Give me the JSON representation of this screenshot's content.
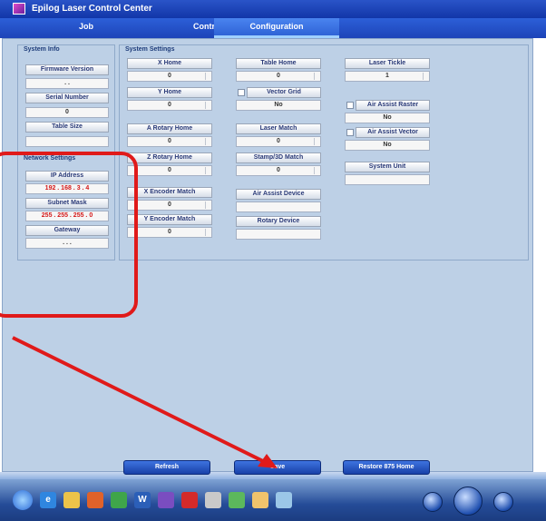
{
  "window": {
    "title": "Epilog Laser Control Center"
  },
  "tabs": [
    {
      "label": "Job"
    },
    {
      "label": "Control"
    },
    {
      "label": "Configuration"
    }
  ],
  "system_info": {
    "label": "System Info",
    "firmware_version": {
      "label": "Firmware Version",
      "value": ". ."
    },
    "serial_number": {
      "label": "Serial Number",
      "value": "0"
    },
    "table_size": {
      "label": "Table Size",
      "value": ""
    }
  },
  "network": {
    "label": "Network Settings",
    "ip_address": {
      "label": "IP Address",
      "value": "192 . 168 . 3 . 4"
    },
    "subnet_mask": {
      "label": "Subnet Mask",
      "value": "255 . 255 . 255 . 0"
    },
    "gateway": {
      "label": "Gateway",
      "value": ". . ."
    }
  },
  "system_settings": {
    "label": "System Settings",
    "col1": [
      {
        "label": "X Home",
        "value": "0"
      },
      {
        "label": "Y Home",
        "value": "0"
      },
      {
        "label": "A Rotary Home",
        "value": "0"
      },
      {
        "label": "Z Rotary Home",
        "value": "0"
      },
      {
        "label": "X Encoder Match",
        "value": "0"
      },
      {
        "label": "Y Encoder Match",
        "value": "0"
      }
    ],
    "col2": [
      {
        "label": "Table Home",
        "value": "0"
      },
      {
        "label": "Vector Grid",
        "value": "No"
      },
      {
        "label": "Laser Match",
        "value": "0"
      },
      {
        "label": "Stamp/3D Match",
        "value": "0"
      },
      {
        "label": "Air Assist Device",
        "value": ""
      },
      {
        "label": "Rotary Device",
        "value": ""
      }
    ],
    "col3": [
      {
        "label": "Laser Tickle",
        "value": "1"
      },
      {
        "label": "Air Assist Raster",
        "value": "No"
      },
      {
        "label": "Air Assist Vector",
        "value": "No"
      },
      {
        "label": "System Unit",
        "value": ""
      }
    ]
  },
  "actions": {
    "refresh": "Refresh",
    "save": "Save",
    "restore": "Restore 875 Home"
  },
  "taskbar": {
    "items": [
      "W"
    ]
  }
}
